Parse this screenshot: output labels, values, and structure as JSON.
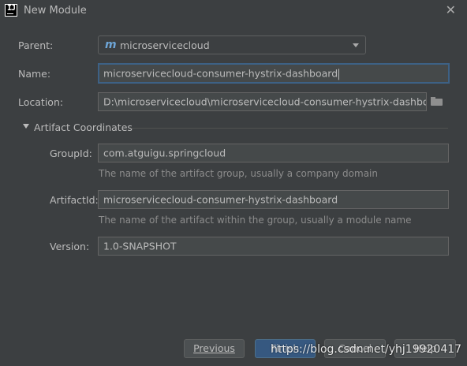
{
  "window": {
    "title": "New Module",
    "app_icon_text": "IJ"
  },
  "parent": {
    "label": "Parent:",
    "value": "microservicecloud",
    "icon": "maven-m-icon"
  },
  "name": {
    "label": "Name:",
    "value": "microservicecloud-consumer-hystrix-dashboard"
  },
  "location": {
    "label": "Location:",
    "value": "D:\\microservicecloud\\microservicecloud-consumer-hystrix-dashboard"
  },
  "artifact_section": {
    "title": "Artifact Coordinates",
    "group_id": {
      "label": "GroupId:",
      "value": "com.atguigu.springcloud",
      "hint": "The name of the artifact group, usually a company domain"
    },
    "artifact_id": {
      "label": "ArtifactId:",
      "value": "microservicecloud-consumer-hystrix-dashboard",
      "hint": "The name of the artifact within the group, usually a module name"
    },
    "version": {
      "label": "Version:",
      "value": "1.0-SNAPSHOT"
    }
  },
  "buttons": {
    "previous": "Previous",
    "finish": "Finish",
    "cancel": "Cancel",
    "help": "Help"
  },
  "watermark": "https://blog.csdn.net/yhj19920417",
  "colors": {
    "background": "#3c3f41",
    "field_bg": "#45494a",
    "focus_border": "#3d6185",
    "primary_button": "#365880",
    "hint_text": "#8c8c8c"
  }
}
